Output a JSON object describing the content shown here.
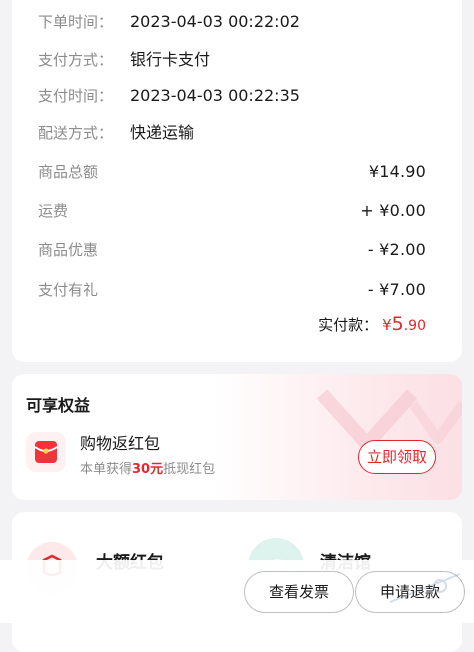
{
  "order": {
    "rows": [
      {
        "label": "下单时间：",
        "value": "2023-04-03 00:22:02"
      },
      {
        "label": "支付方式：",
        "value": "银行卡支付"
      },
      {
        "label": "支付时间：",
        "value": "2023-04-03 00:22:35"
      },
      {
        "label": "配送方式：",
        "value": "快递运输"
      }
    ],
    "amounts": [
      {
        "label": "商品总额",
        "value": "¥14.90"
      },
      {
        "label": "运费",
        "value": "+ ¥0.00"
      },
      {
        "label": "商品优惠",
        "value": "- ¥2.00"
      },
      {
        "label": "支付有礼",
        "value": "- ¥7.00"
      }
    ],
    "paid": {
      "label": "实付款：",
      "currency": "¥",
      "integer": "5",
      "decimal": ".90"
    }
  },
  "benefits": {
    "title": "可享权益",
    "item": {
      "name": "购物返红包",
      "desc_prefix": "本单获得",
      "desc_amount": "30元",
      "desc_suffix": "抵现红包",
      "button": "立即领取"
    }
  },
  "promos": [
    {
      "name": "大额红包",
      "icon": "red-packet-icon"
    },
    {
      "name": "清洁馆",
      "icon": "cleaning-icon"
    }
  ],
  "actions": {
    "invoice": "查看发票",
    "refund": "申请退款"
  },
  "colors": {
    "accent": "#e0282e",
    "background": "#f3f3f5"
  }
}
